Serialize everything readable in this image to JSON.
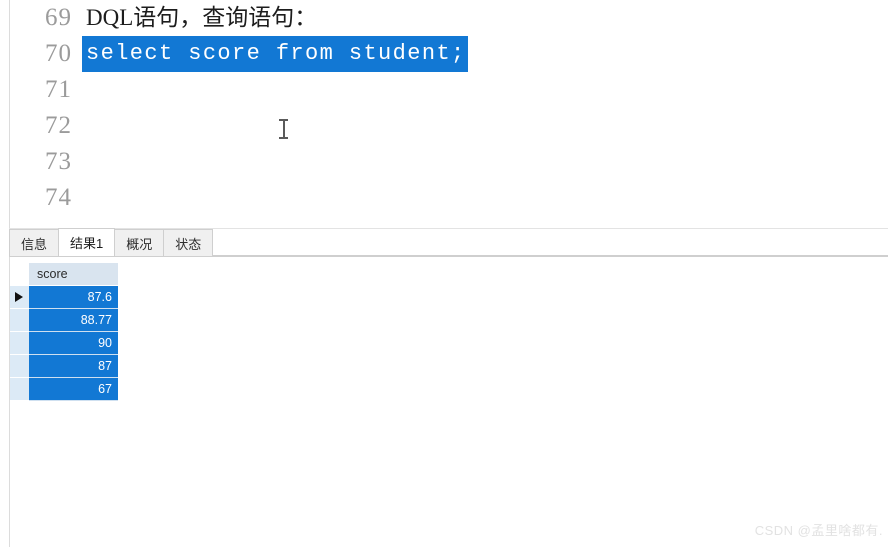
{
  "editor": {
    "lines": [
      {
        "number": "69",
        "text": "DQL语句，查询语句：",
        "selected": false,
        "style": "plain"
      },
      {
        "number": "70",
        "text": "select score from student;",
        "selected": true,
        "style": "code"
      },
      {
        "number": "71",
        "text": "",
        "selected": false,
        "style": "code"
      },
      {
        "number": "72",
        "text": "",
        "selected": false,
        "style": "code"
      },
      {
        "number": "73",
        "text": "",
        "selected": false,
        "style": "code"
      },
      {
        "number": "74",
        "text": "",
        "selected": false,
        "style": "code"
      }
    ],
    "selection_color": "#1278d4",
    "gutter_color": "#9b9b9b"
  },
  "tabs": [
    {
      "label": "信息",
      "active": false
    },
    {
      "label": "结果1",
      "active": true
    },
    {
      "label": "概况",
      "active": false
    },
    {
      "label": "状态",
      "active": false
    }
  ],
  "result_grid": {
    "columns": [
      "score"
    ],
    "rows": [
      {
        "score": "87.6",
        "current": true
      },
      {
        "score": "88.77",
        "current": false
      },
      {
        "score": "90",
        "current": false
      },
      {
        "score": "87",
        "current": false
      },
      {
        "score": "67",
        "current": false
      }
    ],
    "selection_color": "#1278d4",
    "header_color": "#d9e4ef"
  },
  "watermark": {
    "text": "CSDN @孟里啥都有."
  }
}
